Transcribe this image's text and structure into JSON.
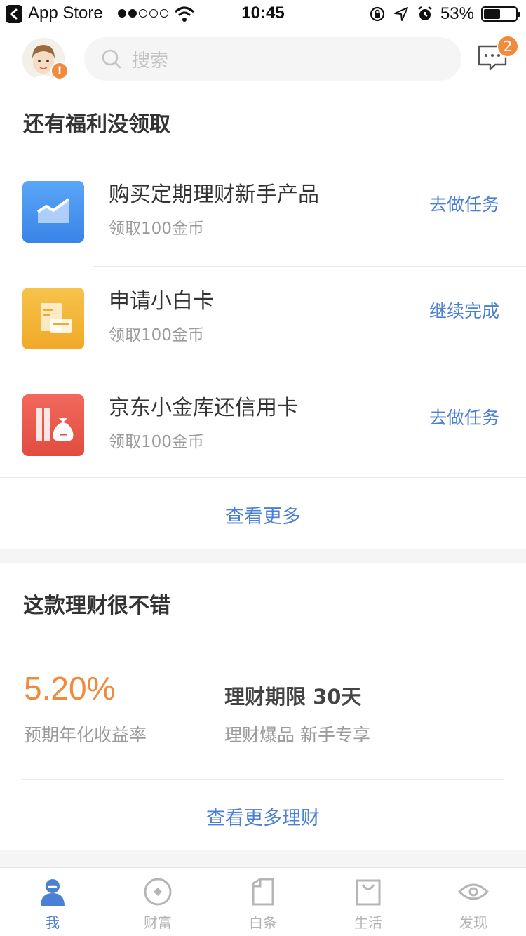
{
  "status_bar": {
    "back_app": "App Store",
    "time": "10:45",
    "battery": "53%",
    "battery_level": 0.53
  },
  "header": {
    "search_placeholder": "搜索",
    "avatar_badge": "!",
    "message_count": "2"
  },
  "welfare": {
    "title": "还有福利没领取",
    "tasks": [
      {
        "title": "购买定期理财新手产品",
        "subtitle": "领取100金币",
        "action": "去做任务",
        "icon": "chart-icon",
        "color": "#4a90e2"
      },
      {
        "title": "申请小白卡",
        "subtitle": "领取100金币",
        "action": "继续完成",
        "icon": "card-icon",
        "color": "#f2b632"
      },
      {
        "title": "京东小金库还信用卡",
        "subtitle": "领取100金币",
        "action": "去做任务",
        "icon": "money-bag-icon",
        "color": "#e8524a"
      }
    ],
    "see_more": "查看更多"
  },
  "finance": {
    "title": "这款理财很不错",
    "rate": "5.20%",
    "rate_label": "预期年化收益率",
    "term": "理财期限 30天",
    "term_sub": "理财爆品 新手专享",
    "see_more": "查看更多理财"
  },
  "tabbar": {
    "active": "我",
    "tabs": [
      {
        "label": "我",
        "icon": "person-icon"
      },
      {
        "label": "财富",
        "icon": "coin-icon"
      },
      {
        "label": "白条",
        "icon": "note-icon"
      },
      {
        "label": "生活",
        "icon": "bag-icon"
      },
      {
        "label": "发现",
        "icon": "eye-icon"
      }
    ]
  },
  "colors": {
    "accent_blue": "#4a7fd4",
    "accent_orange": "#f08a3c"
  }
}
